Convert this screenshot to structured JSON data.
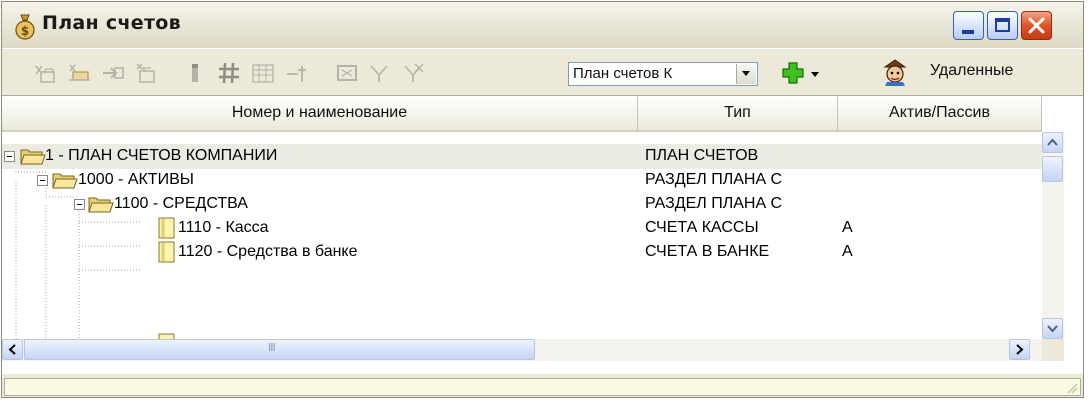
{
  "window": {
    "title": "План счетов"
  },
  "toolbar": {
    "icons": [
      "add-folder-icon",
      "add-child-icon",
      "move-icon",
      "edit-icon",
      "hand-icon",
      "grid-icon",
      "table-icon",
      "insert-icon",
      "fill-icon",
      "filter-icon",
      "clear-filter-icon"
    ],
    "combo_value": "План счетов К",
    "add_icon": "green-plus-icon",
    "deleted_label": "Удаленные"
  },
  "table": {
    "columns": [
      "Номер и наименование",
      "Тип",
      "Актив/Пассив"
    ],
    "rows": [
      {
        "name": "1 - ПЛАН СЧЕТОВ КОМПАНИИ",
        "type": "ПЛАН СЧЕТОВ",
        "ap": ""
      },
      {
        "name": "1000 - АКТИВЫ",
        "type": "РАЗДЕЛ ПЛАНА С",
        "ap": ""
      },
      {
        "name": "1100 - СРЕДСТВА",
        "type": "РАЗДЕЛ ПЛАНА С",
        "ap": ""
      },
      {
        "name": "1110 - Касса",
        "type": "СЧЕТА КАССЫ",
        "ap": "А"
      },
      {
        "name": "1120 - Средства в банке",
        "type": "СЧЕТА В БАНКЕ",
        "ap": "А"
      }
    ]
  },
  "hscroll_grip": "III",
  "colors": {
    "title_bg": "#ece9d8",
    "close_button": "#e2522a",
    "status_bg": "#fbfbe3"
  }
}
